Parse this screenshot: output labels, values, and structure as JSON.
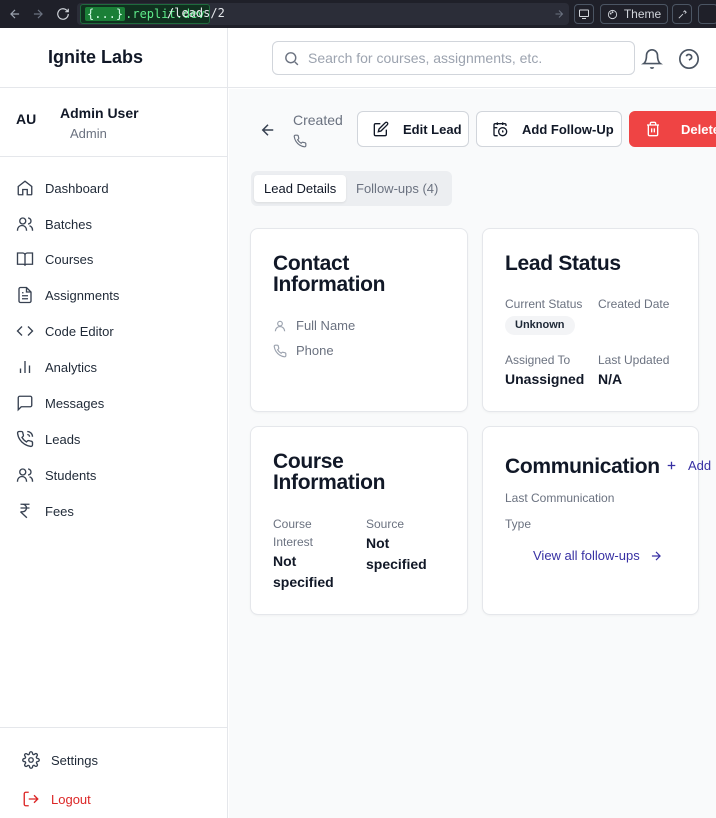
{
  "browser": {
    "domain_brace": "{...}",
    "domain_suffix": ".replit.dev",
    "path": "/leads/2",
    "theme_label": "Theme"
  },
  "sidebar": {
    "brand": "Ignite Labs",
    "user": {
      "initials": "AU",
      "name": "Admin User",
      "role": "Admin"
    },
    "nav": [
      {
        "label": "Dashboard",
        "icon": "home-icon"
      },
      {
        "label": "Batches",
        "icon": "users-icon"
      },
      {
        "label": "Courses",
        "icon": "book-icon"
      },
      {
        "label": "Assignments",
        "icon": "file-text-icon"
      },
      {
        "label": "Code Editor",
        "icon": "code-icon"
      },
      {
        "label": "Analytics",
        "icon": "bar-chart-icon"
      },
      {
        "label": "Messages",
        "icon": "message-icon"
      },
      {
        "label": "Leads",
        "icon": "phone-call-icon"
      },
      {
        "label": "Students",
        "icon": "users-icon"
      },
      {
        "label": "Fees",
        "icon": "rupee-icon"
      }
    ],
    "settings_label": "Settings",
    "logout_label": "Logout"
  },
  "header": {
    "search_placeholder": "Search for courses, assignments, etc."
  },
  "lead": {
    "created_label": "Created",
    "edit_label": "Edit Lead",
    "followup_label": "Add Follow-Up",
    "delete_label": "Delete",
    "tabs": [
      {
        "label": "Lead Details",
        "active": true
      },
      {
        "label": "Follow-ups (4)",
        "active": false
      }
    ],
    "contact": {
      "title_line1": "Contact",
      "title_line2": "Information",
      "full_name_label": "Full Name",
      "phone_label": "Phone"
    },
    "status": {
      "title": "Lead Status",
      "current_status_label": "Current Status",
      "current_status_value": "Unknown",
      "created_date_label": "Created Date",
      "assigned_to_label": "Assigned To",
      "assigned_to_value": "Unassigned",
      "last_updated_label": "Last Updated",
      "last_updated_value": "N/A"
    },
    "course": {
      "title_line1": "Course",
      "title_line2": "Information",
      "interest_label_1": "Course",
      "interest_label_2": "Interest",
      "interest_value_1": "Not",
      "interest_value_2": "specified",
      "source_label": "Source",
      "source_value_1": "Not",
      "source_value_2": "specified"
    },
    "communication": {
      "title": "Communication",
      "add_label": "Add",
      "last_comm_label": "Last Communication",
      "type_label": "Type",
      "view_all_label": "View all follow-ups"
    }
  },
  "colors": {
    "accent": "#3730a3",
    "danger": "#ef4444",
    "logout": "#dc2626"
  }
}
